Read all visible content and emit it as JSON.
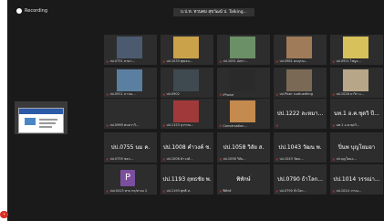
{
  "topbar": {
    "recording_label": "Recording",
    "speaking_label": "บ.ป.ท. ทวนคม สุขวัฒน์ ป. Talking..."
  },
  "left_panel": {
    "end_label": ""
  },
  "tiles": [
    {
      "label": "ปป.0751 สามก...",
      "big": "",
      "photo": "#4b5a6e"
    },
    {
      "label": "ปป.1033 พุฒจน...",
      "big": "",
      "photo": "#c9a24a"
    },
    {
      "label": "ปป.1051 อัลก่า...",
      "big": "",
      "photo": "#6b8f66"
    },
    {
      "label": "ปป.0981 คหบุรณ...",
      "big": "",
      "photo": "#a07b5a"
    },
    {
      "label": "ปป.0921 ไพบูล...",
      "big": "",
      "photo": "#d6c15a"
    },
    {
      "label": "ปป.0911 ลาวณ...",
      "big": "",
      "photo": "#5a7fa0"
    },
    {
      "label": "ปป.0902",
      "big": "",
      "photo": "#3f4a50"
    },
    {
      "label": "iPhone",
      "big": "",
      "photo": "#2a2a2a"
    },
    {
      "label": "ปป.Phair sudtuedting",
      "big": "",
      "photo": "#7a6a55"
    },
    {
      "label": "ปป.1028 ธาวิก บ...",
      "big": "",
      "photo": "#b8a688"
    },
    {
      "label": "ปป.0969 พนหวาวิ...",
      "big": "",
      "photo": ""
    },
    {
      "label": "ปป.1153 สุวรรณ...",
      "big": "",
      "photo": "#a03a3a"
    },
    {
      "label": "Conversation...",
      "big": "",
      "photo": "#c58a4e"
    },
    {
      "label": "",
      "big": "ปป.1222 ละหมา...",
      "photo": ""
    },
    {
      "label": "นท.1 อ.ค.ชุดวิ...",
      "big": "นท.1 อ.ค.ชุดวิ ปี...",
      "photo": ""
    },
    {
      "label": "ปป.0755 ชอบ...",
      "big": "ปป.0755 นม ค.",
      "photo": ""
    },
    {
      "label": "ปป.1008 คำวงค์...",
      "big": "ปป.1008 คำวงค์ ช.",
      "photo": ""
    },
    {
      "label": "ปป.1058 วิลัย...",
      "big": "ปป.1058 วิลัย ส.",
      "photo": ""
    },
    {
      "label": "ปป.1043 วัฒน...",
      "big": "ปป.1043 วัฒน พ.",
      "photo": ""
    },
    {
      "label": "ปป.บุญโยมอ...",
      "big": "ปิ่นพ บุญโยมอา",
      "photo": ""
    },
    {
      "label": "ปปะ0413 ทาบ ทร/ทางบ 2",
      "big": "",
      "photo": "",
      "avatar": "P"
    },
    {
      "label": "ปป.1193 พุทธิ ห.",
      "big": "ปป.1193 ฤทธชัย พ.",
      "photo": ""
    },
    {
      "label": "พิทักษ์",
      "big": "พิทักษ์",
      "photo": ""
    },
    {
      "label": "ปป.0790 ชั่วโลก...",
      "big": "ปป.0790 ธ้าโลก...",
      "photo": ""
    },
    {
      "label": "ปป.1014 วรรณ...",
      "big": "ปป.1014 วรรณ่า...",
      "photo": ""
    }
  ]
}
